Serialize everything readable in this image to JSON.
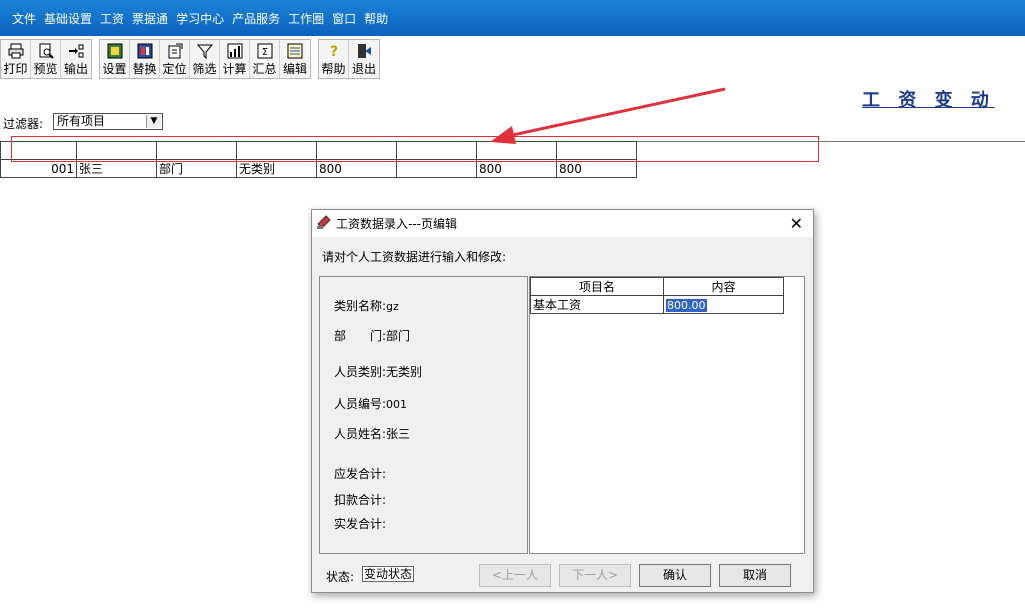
{
  "menu": [
    "文件",
    "基础设置",
    "工资",
    "票据通",
    "学习中心",
    "产品服务",
    "工作圈",
    "窗口",
    "帮助"
  ],
  "toolbar": {
    "group1": [
      {
        "label": "打印",
        "icon": "printer-icon"
      },
      {
        "label": "预览",
        "icon": "preview-icon"
      },
      {
        "label": "输出",
        "icon": "export-icon"
      }
    ],
    "group2": [
      {
        "label": "设置",
        "icon": "settings-icon"
      },
      {
        "label": "替换",
        "icon": "replace-icon"
      },
      {
        "label": "定位",
        "icon": "locate-icon"
      },
      {
        "label": "筛选",
        "icon": "filter-icon"
      },
      {
        "label": "计算",
        "icon": "calculate-icon"
      },
      {
        "label": "汇总",
        "icon": "sum-icon"
      },
      {
        "label": "编辑",
        "icon": "edit-icon"
      }
    ],
    "group3": [
      {
        "label": "帮助",
        "icon": "help-icon"
      },
      {
        "label": "退出",
        "icon": "exit-icon"
      }
    ]
  },
  "page_title": "工 资 变 动",
  "filter": {
    "label": "过滤器:",
    "value": "所有项目"
  },
  "grid": {
    "header": [
      "",
      "",
      "",
      "",
      "",
      "",
      "",
      ""
    ],
    "rows": [
      [
        "001",
        "张三",
        "部门",
        "无类别",
        "800",
        "",
        "800",
        "800"
      ]
    ]
  },
  "dialog": {
    "title": "工资数据录入---页编辑",
    "instruction": "请对个人工资数据进行输入和修改:",
    "fields": [
      {
        "label": "类别名称:",
        "value": "gz"
      },
      {
        "label": "部　　门:",
        "value": "部门"
      },
      {
        "label": "人员类别:",
        "value": "无类别"
      },
      {
        "label": "人员编号:",
        "value": "001"
      },
      {
        "label": "人员姓名:",
        "value": "张三"
      },
      {
        "label": "应发合计:",
        "value": ""
      },
      {
        "label": "扣款合计:",
        "value": ""
      },
      {
        "label": "实发合计:",
        "value": ""
      }
    ],
    "table": {
      "headers": [
        "项目名",
        "内容"
      ],
      "rows": [
        {
          "name": "基本工资",
          "value": "800.00"
        }
      ]
    },
    "status_label": "状态:",
    "status_value": "变动状态",
    "buttons": {
      "prev": "<上一人",
      "next": "下一人>",
      "ok": "确认",
      "cancel": "取消"
    }
  },
  "colors": {
    "menubar": "#0b63bf",
    "highlight": "#e0303b",
    "selection": "#3264c8",
    "title": "#1b3a8a"
  }
}
